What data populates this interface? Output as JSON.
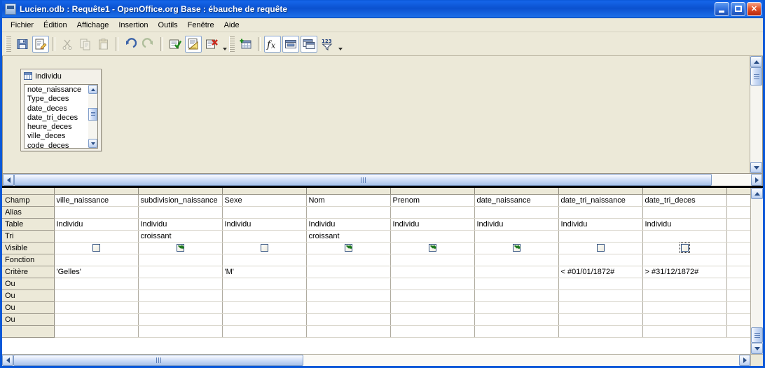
{
  "window": {
    "title": "Lucien.odb : Requête1 - OpenOffice.org Base : ébauche de requête",
    "icon": "base-document-icon",
    "controls": {
      "minimize": "Réduire",
      "maximize": "Agrandir",
      "close": "Fermer"
    }
  },
  "menubar": {
    "items": [
      {
        "label": "Fichier",
        "name": "menu-fichier"
      },
      {
        "label": "Édition",
        "name": "menu-edition"
      },
      {
        "label": "Affichage",
        "name": "menu-affichage"
      },
      {
        "label": "Insertion",
        "name": "menu-insertion"
      },
      {
        "label": "Outils",
        "name": "menu-outils"
      },
      {
        "label": "Fenêtre",
        "name": "menu-fenetre"
      },
      {
        "label": "Aide",
        "name": "menu-aide"
      }
    ]
  },
  "toolbar": {
    "buttons": [
      {
        "name": "save-button",
        "icon": "floppy-disk-icon",
        "state": "enabled"
      },
      {
        "name": "edit-button",
        "icon": "edit-document-icon",
        "state": "framed"
      },
      {
        "name": "cut-button",
        "icon": "scissors-icon",
        "state": "disabled"
      },
      {
        "name": "copy-button",
        "icon": "copy-icon",
        "state": "disabled"
      },
      {
        "name": "paste-button",
        "icon": "clipboard-icon",
        "state": "disabled"
      },
      {
        "name": "undo-button",
        "icon": "undo-arrow-icon",
        "state": "enabled"
      },
      {
        "name": "redo-button",
        "icon": "redo-arrow-icon",
        "state": "disabled"
      },
      {
        "name": "run-query-button",
        "icon": "run-check-icon",
        "state": "enabled"
      },
      {
        "name": "design-view-button",
        "icon": "design-ruler-icon",
        "state": "framed"
      },
      {
        "name": "clear-query-button",
        "icon": "delete-red-x-icon",
        "state": "enabled"
      },
      {
        "name": "add-table-button",
        "icon": "add-table-icon",
        "state": "enabled"
      },
      {
        "name": "functions-button",
        "icon": "fx-function-icon",
        "state": "framed"
      },
      {
        "name": "table-names-button",
        "icon": "table-names-icon",
        "state": "framed"
      },
      {
        "name": "aliases-button",
        "icon": "aliases-icon",
        "state": "framed"
      },
      {
        "name": "distinct-values-button",
        "icon": "filter-123-icon",
        "state": "enabled"
      }
    ]
  },
  "design_pane": {
    "table": {
      "name": "Individu",
      "icon": "table-grid-icon",
      "fields": [
        "note_naissance",
        "Type_deces",
        "date_deces",
        "date_tri_deces",
        "heure_deces",
        "ville_deces",
        "code_deces"
      ]
    }
  },
  "query_grid": {
    "row_labels": [
      "Champ",
      "Alias",
      "Table",
      "Tri",
      "Visible",
      "Fonction",
      "Critère",
      "Ou",
      "Ou",
      "Ou",
      "Ou"
    ],
    "columns": [
      {
        "champ": "ville_naissance",
        "alias": "",
        "table": "Individu",
        "tri": "",
        "visible": false,
        "visible_focus": false,
        "fonction": "",
        "critere": "'Gelles'",
        "ou": [
          "",
          "",
          "",
          ""
        ]
      },
      {
        "champ": "subdivision_naissance",
        "alias": "",
        "table": "Individu",
        "tri": "croissant",
        "visible": true,
        "visible_focus": false,
        "fonction": "",
        "critere": "",
        "ou": [
          "",
          "",
          "",
          ""
        ]
      },
      {
        "champ": "Sexe",
        "alias": "",
        "table": "Individu",
        "tri": "",
        "visible": false,
        "visible_focus": false,
        "fonction": "",
        "critere": "'M'",
        "ou": [
          "",
          "",
          "",
          ""
        ]
      },
      {
        "champ": "Nom",
        "alias": "",
        "table": "Individu",
        "tri": "croissant",
        "visible": true,
        "visible_focus": false,
        "fonction": "",
        "critere": "",
        "ou": [
          "",
          "",
          "",
          ""
        ]
      },
      {
        "champ": "Prenom",
        "alias": "",
        "table": "Individu",
        "tri": "",
        "visible": true,
        "visible_focus": false,
        "fonction": "",
        "critere": "",
        "ou": [
          "",
          "",
          "",
          ""
        ]
      },
      {
        "champ": "date_naissance",
        "alias": "",
        "table": "Individu",
        "tri": "",
        "visible": true,
        "visible_focus": false,
        "fonction": "",
        "critere": "",
        "ou": [
          "",
          "",
          "",
          ""
        ]
      },
      {
        "champ": "date_tri_naissance",
        "alias": "",
        "table": "Individu",
        "tri": "",
        "visible": false,
        "visible_focus": false,
        "fonction": "",
        "critere": "< #01/01/1872#",
        "ou": [
          "",
          "",
          "",
          ""
        ]
      },
      {
        "champ": "date_tri_deces",
        "alias": "",
        "table": "Individu",
        "tri": "",
        "visible": false,
        "visible_focus": true,
        "fonction": "",
        "critere": "> #31/12/1872#",
        "ou": [
          "",
          "",
          "",
          ""
        ]
      },
      {
        "champ": "",
        "alias": "",
        "table": "",
        "tri": "",
        "visible": null,
        "visible_focus": false,
        "fonction": "",
        "critere": "",
        "ou": [
          "",
          "",
          "",
          ""
        ]
      }
    ]
  },
  "scrollbars": {
    "upper_vertical": {
      "name": "upper-pane-vscrollbar"
    },
    "design_horizontal": {
      "name": "design-pane-hscrollbar"
    },
    "grid_vertical": {
      "name": "grid-vscrollbar"
    },
    "grid_horizontal": {
      "name": "grid-hscrollbar"
    }
  },
  "colors": {
    "title_bar": "#0b51cf",
    "window_face": "#ece9d8",
    "grid_header": "#ece9d8",
    "check_green": "#1f7a1f",
    "scroll_blue": "#a8c2e9"
  }
}
